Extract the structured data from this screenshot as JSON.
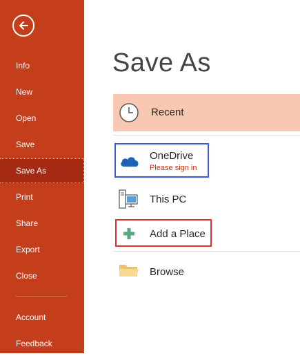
{
  "sidebar": {
    "back_icon": "back-arrow-icon",
    "items": [
      {
        "label": "Info"
      },
      {
        "label": "New"
      },
      {
        "label": "Open"
      },
      {
        "label": "Save"
      },
      {
        "label": "Save As",
        "selected": true
      },
      {
        "label": "Print"
      },
      {
        "label": "Share"
      },
      {
        "label": "Export"
      },
      {
        "label": "Close"
      },
      {
        "label": "Account"
      },
      {
        "label": "Feedback"
      }
    ]
  },
  "main": {
    "title": "Save As",
    "places": [
      {
        "label": "Recent",
        "icon": "clock-icon",
        "selected": true
      },
      {
        "label": "OneDrive",
        "sublabel": "Please sign in",
        "icon": "cloud-icon"
      },
      {
        "label": "This PC",
        "icon": "computer-icon"
      },
      {
        "label": "Add a Place",
        "icon": "plus-icon"
      },
      {
        "label": "Browse",
        "icon": "folder-icon"
      }
    ]
  },
  "colors": {
    "sidebar_bg": "#c43e1c",
    "sidebar_selected": "#a52a14",
    "recent_highlight": "#f9c8b3",
    "onedrive_box": "#3b5bdb",
    "add_place_box": "#e03131",
    "signin_text": "#c23616"
  }
}
